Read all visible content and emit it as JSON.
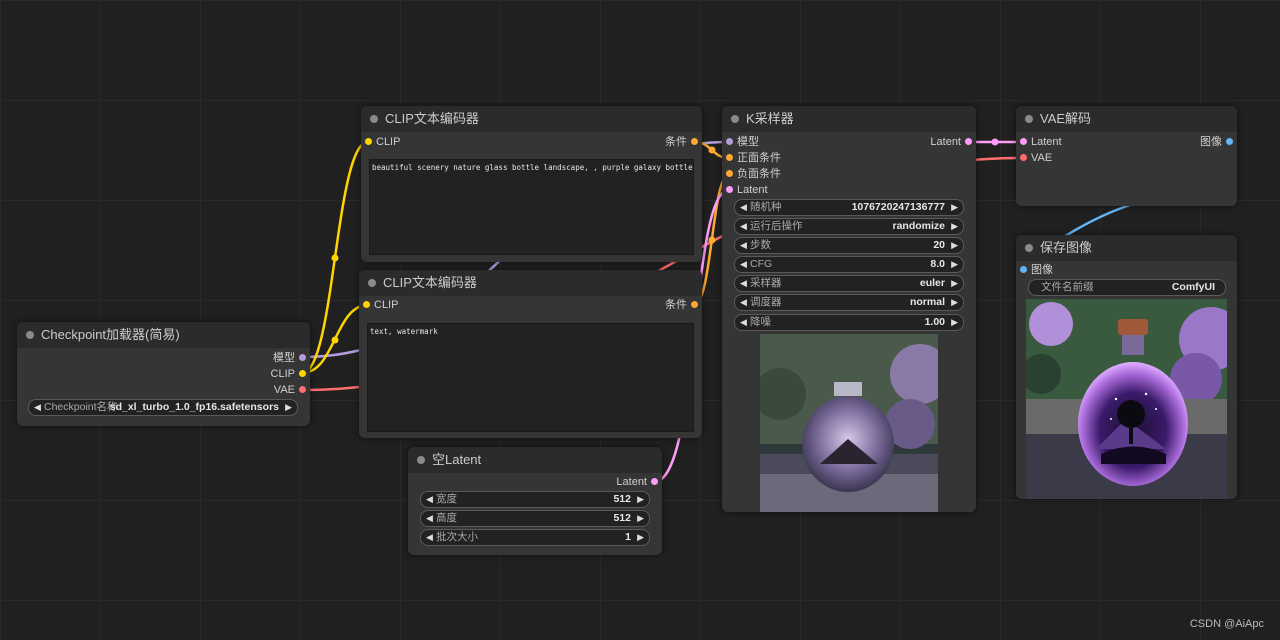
{
  "colors": {
    "clip": "#FFD500",
    "conditioning": "#FFA931",
    "model": "#B39DDB",
    "vae": "#FF6E6E",
    "latent": "#FF9CF9",
    "image": "#64B5F6"
  },
  "nodes": {
    "checkpoint": {
      "title": "Checkpoint加载器(简易)",
      "outputs": [
        "模型",
        "CLIP",
        "VAE"
      ],
      "widget_label": "Checkpoint名称",
      "widget_value": "sd_xl_turbo_1.0_fp16.safetensors"
    },
    "clip_pos": {
      "title": "CLIP文本编码器",
      "input": "CLIP",
      "output": "条件",
      "text": "beautiful scenery nature glass bottle landscape, , purple galaxy bottle,"
    },
    "clip_neg": {
      "title": "CLIP文本编码器",
      "input": "CLIP",
      "output": "条件",
      "text": "text, watermark"
    },
    "empty_latent": {
      "title": "空Latent",
      "output": "Latent",
      "widgets": [
        {
          "label": "宽度",
          "value": "512"
        },
        {
          "label": "高度",
          "value": "512"
        },
        {
          "label": "批次大小",
          "value": "1"
        }
      ]
    },
    "ksampler": {
      "title": "K采样器",
      "inputs": [
        "模型",
        "正面条件",
        "负面条件",
        "Latent"
      ],
      "output": "Latent",
      "widgets": [
        {
          "label": "随机种",
          "value": "1076720247136777"
        },
        {
          "label": "运行后操作",
          "value": "randomize"
        },
        {
          "label": "步数",
          "value": "20"
        },
        {
          "label": "CFG",
          "value": "8.0"
        },
        {
          "label": "采样器",
          "value": "euler"
        },
        {
          "label": "调度器",
          "value": "normal"
        },
        {
          "label": "降噪",
          "value": "1.00"
        }
      ]
    },
    "vae_decode": {
      "title": "VAE解码",
      "inputs": [
        "Latent",
        "VAE"
      ],
      "output": "图像"
    },
    "save_image": {
      "title": "保存图像",
      "input": "图像",
      "widget_label": "文件名前缀",
      "widget_value": "ComfyUI"
    }
  },
  "watermark": "CSDN @AiApc"
}
